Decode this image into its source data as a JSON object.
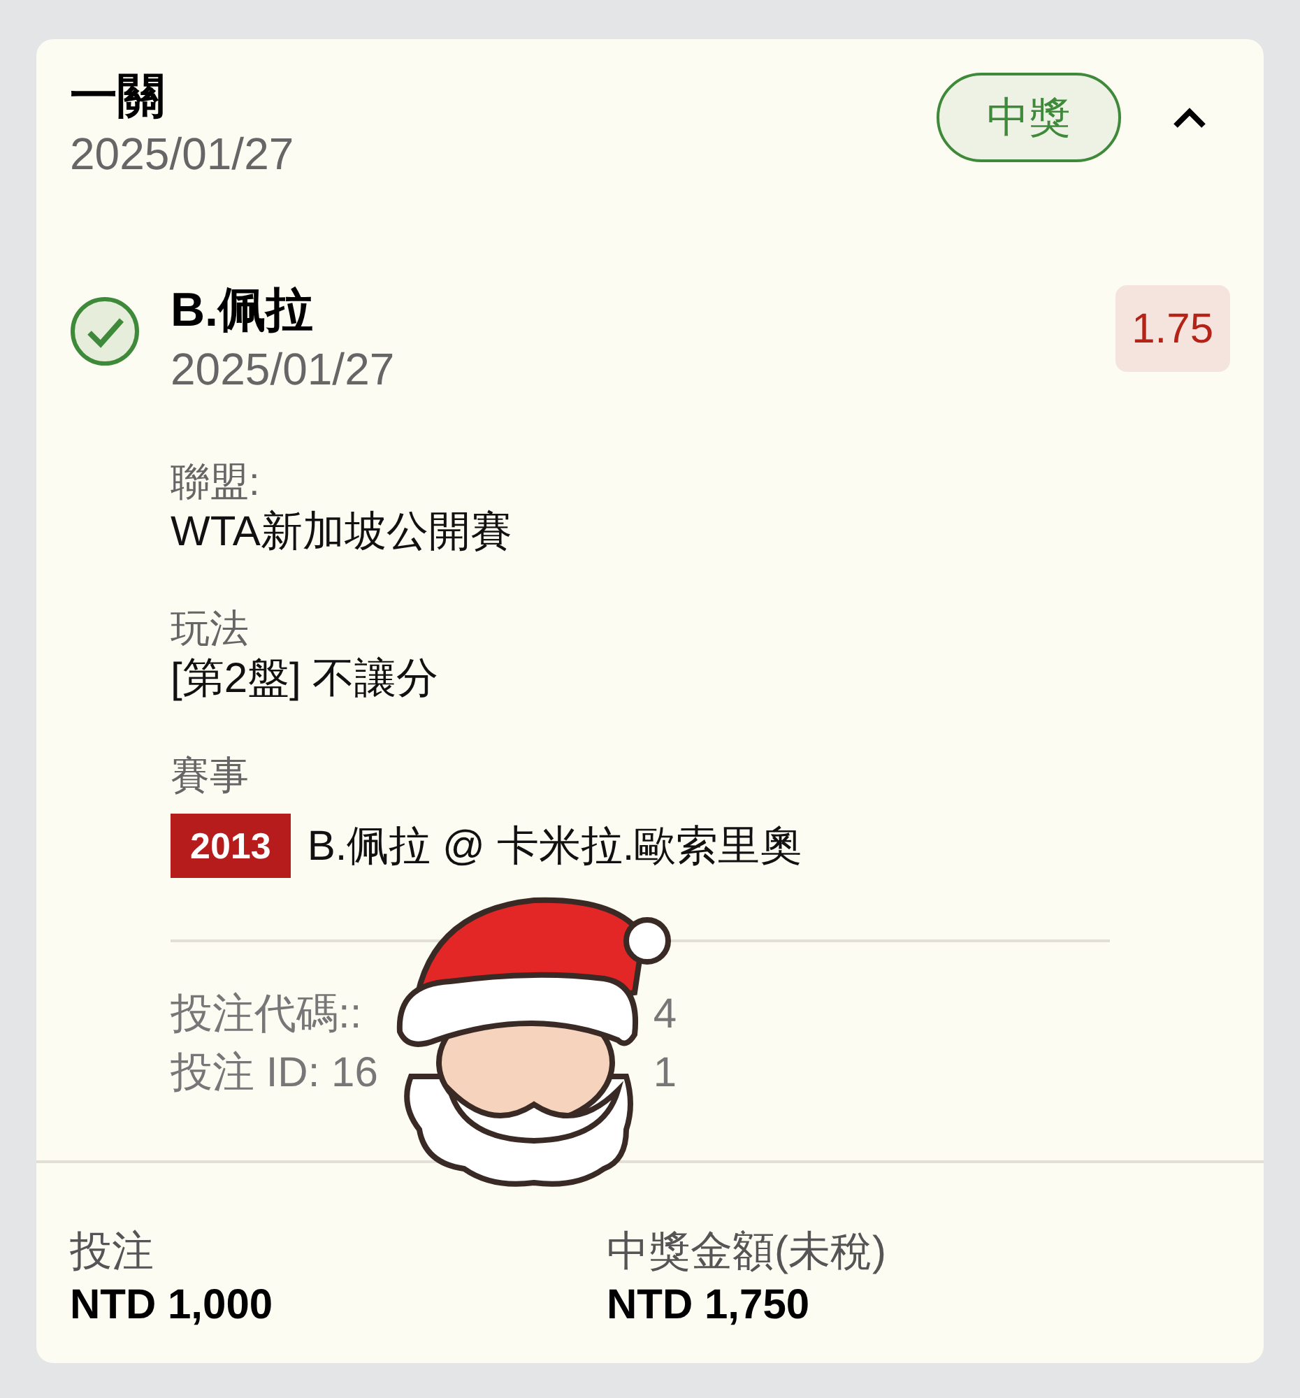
{
  "header": {
    "title": "一關",
    "date": "2025/01/27",
    "status": {
      "label": "中獎",
      "kind": "won"
    },
    "expanded": true
  },
  "selection": {
    "checked": true,
    "name": "B.佩拉",
    "date": "2025/01/27",
    "odds": "1.75"
  },
  "details": [
    {
      "label": "聯盟:",
      "value": "WTA新加坡公開賽"
    },
    {
      "label": "玩法",
      "value": "[第2盤] 不讓分"
    }
  ],
  "event": {
    "label": "賽事",
    "tag": "2013",
    "match": "B.佩拉 @ 卡米拉.歐索里奧"
  },
  "bet_lines": [
    {
      "start": "投注代碼::",
      "end": "4"
    },
    {
      "start": "投注 ID: 16",
      "end": "1"
    }
  ],
  "footer": [
    {
      "label": "投注",
      "value": "NTD 1,000"
    },
    {
      "label": "中獎金額(未稅)",
      "value": "NTD 1,750"
    }
  ]
}
